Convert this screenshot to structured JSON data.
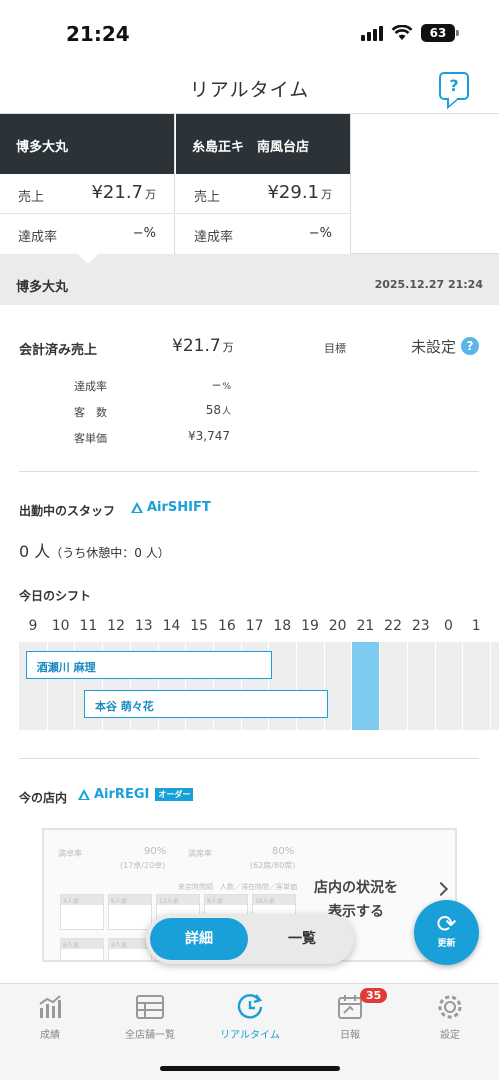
{
  "status_bar": {
    "time": "21:24",
    "battery": "63"
  },
  "header": {
    "title": "リアルタイム",
    "help_icon": "?"
  },
  "stores": [
    {
      "name": "博多大丸",
      "sales_label": "売上",
      "sales_value": "¥21.7",
      "sales_unit": "万",
      "rate_label": "達成率",
      "rate_value": "−%"
    },
    {
      "name": "糸島正キ　南風台店",
      "sales_label": "売上",
      "sales_value": "¥29.1",
      "sales_unit": "万",
      "rate_label": "達成率",
      "rate_value": "−%"
    }
  ],
  "selected_store": {
    "name": "博多大丸",
    "datetime": "2025.12.27 21:24"
  },
  "summary": {
    "sales_label": "会計済み売上",
    "sales_value": "¥21.7",
    "sales_unit": "万",
    "target_label": "目標",
    "target_value": "未設定",
    "target_help": "?",
    "stats": [
      {
        "label": "達成率",
        "value": "−",
        "unit": "%"
      },
      {
        "label": "客　数",
        "value": "58",
        "unit": "人"
      },
      {
        "label": "客単価",
        "value": "¥3,747",
        "unit": ""
      }
    ]
  },
  "staff": {
    "title": "出勤中のスタッフ",
    "logo": "AirSHIFT",
    "count": "0 人",
    "count_detail": "（うち休憩中：0 人）"
  },
  "shift": {
    "title": "今日のシフト",
    "hours": [
      "9",
      "10",
      "11",
      "12",
      "13",
      "14",
      "15",
      "16",
      "17",
      "18",
      "19",
      "20",
      "21",
      "22",
      "23",
      "0",
      "1"
    ],
    "current_hour": 21,
    "bars": [
      {
        "name": "酒瀬川 麻理",
        "start": 9.1,
        "end": 18.0
      },
      {
        "name": "本谷 萌々花",
        "start": 11.2,
        "end": 20.0
      }
    ]
  },
  "store_now": {
    "title": "今の店内",
    "logo": "AirREGI",
    "logo_badge": "オーダー",
    "cta": "店内の状況を\n表示する",
    "preview_text": {
      "t1": "満卓率",
      "v1": "90%",
      "s1": "(17卓/20卓)",
      "t2": "満席率",
      "v2": "80%",
      "s2": "(62席/80席)",
      "legend": "来店時間順　人数／滞在時間／客単価",
      "tables": [
        "4人卓",
        "6人卓",
        "12人卓",
        "8人卓",
        "16人卓"
      ]
    }
  },
  "view_toggle": {
    "active": "詳細",
    "inactive": "一覧"
  },
  "refresh": {
    "label": "更新",
    "icon": "refresh-icon"
  },
  "tabbar": {
    "items": [
      {
        "label": "成績",
        "icon": "chart-icon"
      },
      {
        "label": "全店舗一覧",
        "icon": "list-icon"
      },
      {
        "label": "リアルタイム",
        "icon": "clock-icon"
      },
      {
        "label": "日報",
        "icon": "calendar-icon",
        "badge": "35"
      },
      {
        "label": "設定",
        "icon": "gear-icon"
      }
    ]
  },
  "colors": {
    "accent": "#1aa0d8",
    "dark_header": "#2b3338",
    "now_column": "#7dcaf0",
    "badge": "#e53935"
  }
}
